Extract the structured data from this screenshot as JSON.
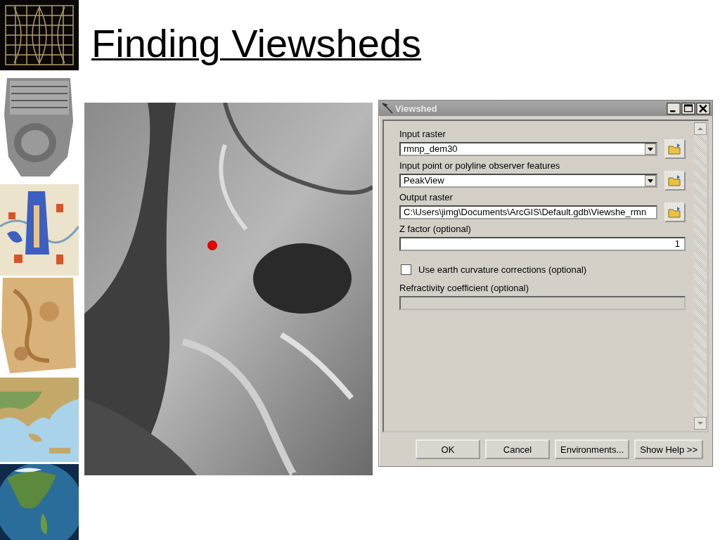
{
  "slide": {
    "title": "Finding Viewsheds"
  },
  "dialog": {
    "title": "Viewshed",
    "parameters": [
      {
        "kind": "dropdown",
        "label": "Input raster",
        "value": "rmnp_dem30",
        "browse": true
      },
      {
        "kind": "dropdown",
        "label": "Input point or polyline observer features",
        "value": "PeakView",
        "browse": true
      },
      {
        "kind": "text",
        "label": "Output raster",
        "value": "C:\\Users\\jimg\\Documents\\ArcGIS\\Default.gdb\\Viewshe_rmn",
        "browse": true
      },
      {
        "kind": "number",
        "label": "Z factor (optional)",
        "value": "1",
        "browse": false
      },
      {
        "kind": "checkbox",
        "label": "Use earth curvature corrections (optional)",
        "checked": false
      },
      {
        "kind": "text",
        "label": "Refractivity coefficient (optional)",
        "browse": false,
        "disabled": true
      }
    ],
    "buttons": [
      "OK",
      "Cancel",
      "Environments...",
      "Show Help >>"
    ]
  }
}
